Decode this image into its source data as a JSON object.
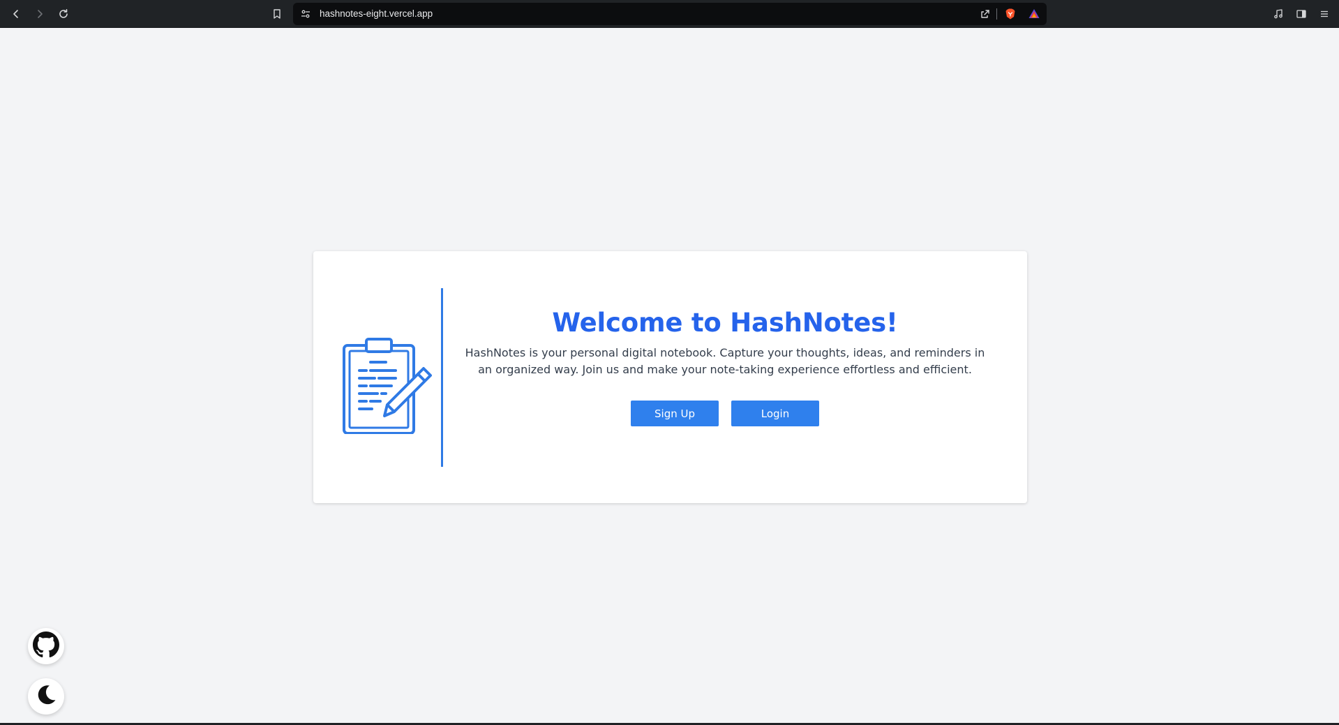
{
  "browser": {
    "url": "hashnotes-eight.vercel.app",
    "icons": {
      "back": "back-arrow-icon",
      "forward": "forward-arrow-icon",
      "reload": "reload-icon",
      "bookmark": "bookmark-icon",
      "site_settings": "site-settings-icon",
      "share": "share-icon",
      "brave_shields": "brave-shields-icon",
      "brave_rewards": "brave-rewards-icon",
      "media": "music-note-icon",
      "sidebar": "sidebar-icon",
      "menu": "hamburger-menu-icon"
    }
  },
  "welcome": {
    "title": "Welcome to HashNotes!",
    "description": "HashNotes is your personal digital notebook. Capture your thoughts, ideas, and reminders in an organized way. Join us and make your note-taking experience effortless and efficient.",
    "signup_label": "Sign Up",
    "login_label": "Login"
  },
  "floating": {
    "github_icon": "github-icon",
    "theme_icon": "moon-icon"
  },
  "colors": {
    "accent": "#2563eb",
    "button": "#2f80ed",
    "page_bg": "#f3f4f6",
    "chrome_bg": "#202326"
  }
}
